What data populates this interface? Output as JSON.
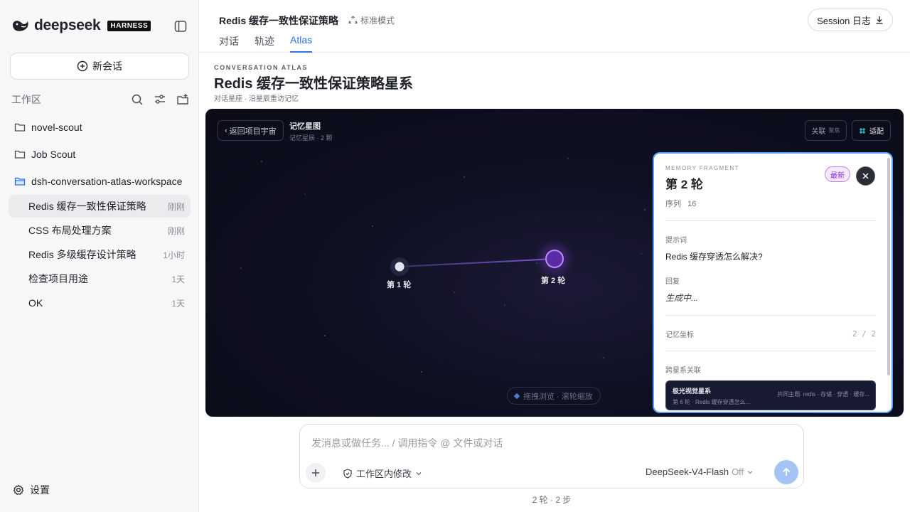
{
  "app": {
    "brand": "deepseek",
    "badge": "HARNESS"
  },
  "sidebar": {
    "new_chat": "新会话",
    "workspace_label": "工作区",
    "folders": [
      {
        "name": "novel-scout"
      },
      {
        "name": "Job Scout"
      },
      {
        "name": "dsh-conversation-atlas-workspace"
      }
    ],
    "conversations": [
      {
        "title": "Redis 缓存一致性保证策略",
        "time": "刚刚",
        "active": true
      },
      {
        "title": "CSS 布局处理方案",
        "time": "刚刚"
      },
      {
        "title": "Redis 多级缓存设计策略",
        "time": "1小时"
      },
      {
        "title": "检查项目用途",
        "time": "1天"
      },
      {
        "title": "OK",
        "time": "1天"
      }
    ],
    "settings": "设置"
  },
  "header": {
    "title": "Redis 缓存一致性保证策略",
    "mode": "标准模式",
    "tabs": [
      {
        "label": "对话"
      },
      {
        "label": "轨迹"
      },
      {
        "label": "Atlas",
        "active": true
      }
    ],
    "session_button": "Session 日志"
  },
  "atlas": {
    "kicker": "CONVERSATION ATLAS",
    "title": "Redis 缓存一致性保证策略星系",
    "subtitle": "对话星座 · 沿星辰重访记忆"
  },
  "canvas": {
    "back_button": "返回项目宇宙",
    "map_title": "记忆星图",
    "map_subtitle": "记忆星辰 · 2 颗",
    "link_button": "关联",
    "link_sub": "聚焦",
    "fit_button": "适配",
    "nodes": [
      {
        "label": "第 1 轮"
      },
      {
        "label": "第 2 轮"
      }
    ],
    "hint": "拖拽浏览 · 滚轮缩放"
  },
  "panel": {
    "kicker": "MEMORY FRAGMENT",
    "title": "第 2 轮",
    "badge": "最新",
    "seq_label": "序列",
    "seq_value": "16",
    "prompt_label": "提示词",
    "prompt": "Redis 缓存穿透怎么解决?",
    "reply_label": "回复",
    "reply": "生成中...",
    "coord_label": "记忆坐标",
    "coord_value": "2 / 2",
    "cross_label": "跨星系关联",
    "galaxy": {
      "title": "极光视觉星系",
      "sub": "第 6 轮 · Redis 缓存穿透怎么...",
      "topics": "共同主题: redis · 存储 · 穿透 · 缓存..."
    }
  },
  "composer": {
    "placeholder": "发消息或做任务... / 调用指令 @ 文件或对话",
    "permission": "工作区内修改",
    "model": "DeepSeek-V4-Flash",
    "model_state": "Off"
  },
  "footer": {
    "stats": "2 轮 · 2 步"
  },
  "colors": {
    "accent": "#2f6feb",
    "node_active": "#9a5cf0",
    "panel_border": "#5aa0ff",
    "badge": "#8c2fd1"
  }
}
